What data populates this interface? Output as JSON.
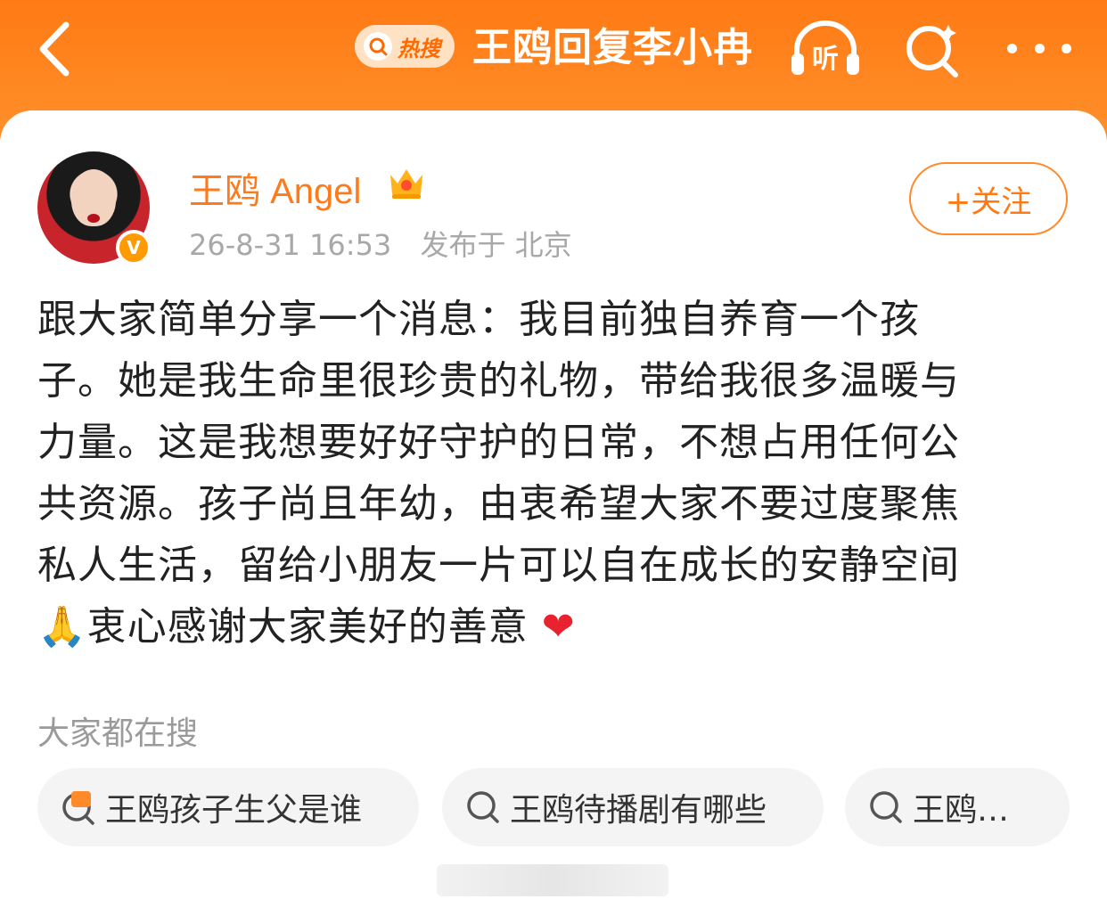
{
  "header": {
    "hot_badge": "热搜",
    "title": "王鸥回复李小冉",
    "listen_label": "听"
  },
  "post": {
    "username": "王鸥 Angel",
    "verified_label": "V",
    "timestamp": "26-8-31 16:53",
    "location": "发布于 北京",
    "follow_label": "+关注",
    "lines": [
      "跟大家简单分享一个消息：我目前独自养育一个孩",
      "子。她是我生命里很珍贵的礼物，带给我很多温暖与",
      "力量。这是我想要好好守护的日常，不想占用任何公",
      "共资源。孩子尚且年幼，由衷希望大家不要过度聚焦",
      "私人生活，留给小朋友一片可以自在成长的安静空间"
    ],
    "last_line_emoji": "🙏",
    "last_line_text": "衷心感谢大家美好的善意",
    "heart_emoji": "❤"
  },
  "trending": {
    "label": "大家都在搜",
    "chips": [
      {
        "text": "王鸥孩子生父是谁",
        "icon": "hot-search-icon"
      },
      {
        "text": "王鸥待播剧有哪些",
        "icon": "search-icon"
      },
      {
        "text": "王鸥…",
        "icon": "search-icon"
      }
    ]
  },
  "colors": {
    "header_orange": "#ff7a14",
    "accent": "#ff8a2a",
    "heart": "#e8222e"
  }
}
